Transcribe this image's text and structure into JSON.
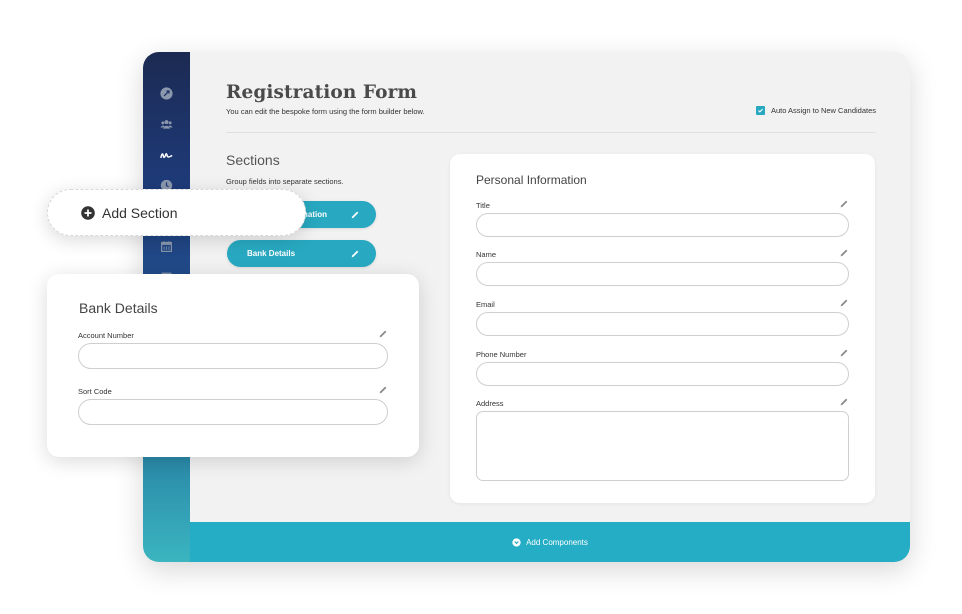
{
  "page": {
    "title": "Registration Form",
    "subtitle": "You can edit the bespoke form using the form builder below.",
    "auto_assign": {
      "label": "Auto Assign to New Candidates",
      "checked": true
    }
  },
  "sidebar": {
    "icons": [
      "rocket-icon",
      "users-icon",
      "signature-icon",
      "clock-icon",
      "calendar-icon",
      "list-icon"
    ]
  },
  "sections": {
    "title": "Sections",
    "description": "Group fields into separate sections.",
    "items": [
      {
        "label": "Personal Information",
        "visible_label": "ation"
      },
      {
        "label": "Bank Details"
      }
    ],
    "add_label": "Add Section"
  },
  "personal_card": {
    "title": "Personal Information",
    "fields": [
      {
        "label": "Title",
        "value": ""
      },
      {
        "label": "Name",
        "value": ""
      },
      {
        "label": "Email",
        "value": ""
      },
      {
        "label": "Phone Number",
        "value": ""
      },
      {
        "label": "Address",
        "value": ""
      }
    ]
  },
  "bank_card": {
    "title": "Bank Details",
    "fields": [
      {
        "label": "Account Number",
        "value": ""
      },
      {
        "label": "Sort Code",
        "value": ""
      }
    ]
  },
  "bottom_bar": {
    "label": "Add Components"
  },
  "colors": {
    "accent": "#28a9c1",
    "bar": "#24adc4",
    "sidebar_top": "#1c2a52",
    "sidebar_bottom": "#3bb5c0"
  }
}
